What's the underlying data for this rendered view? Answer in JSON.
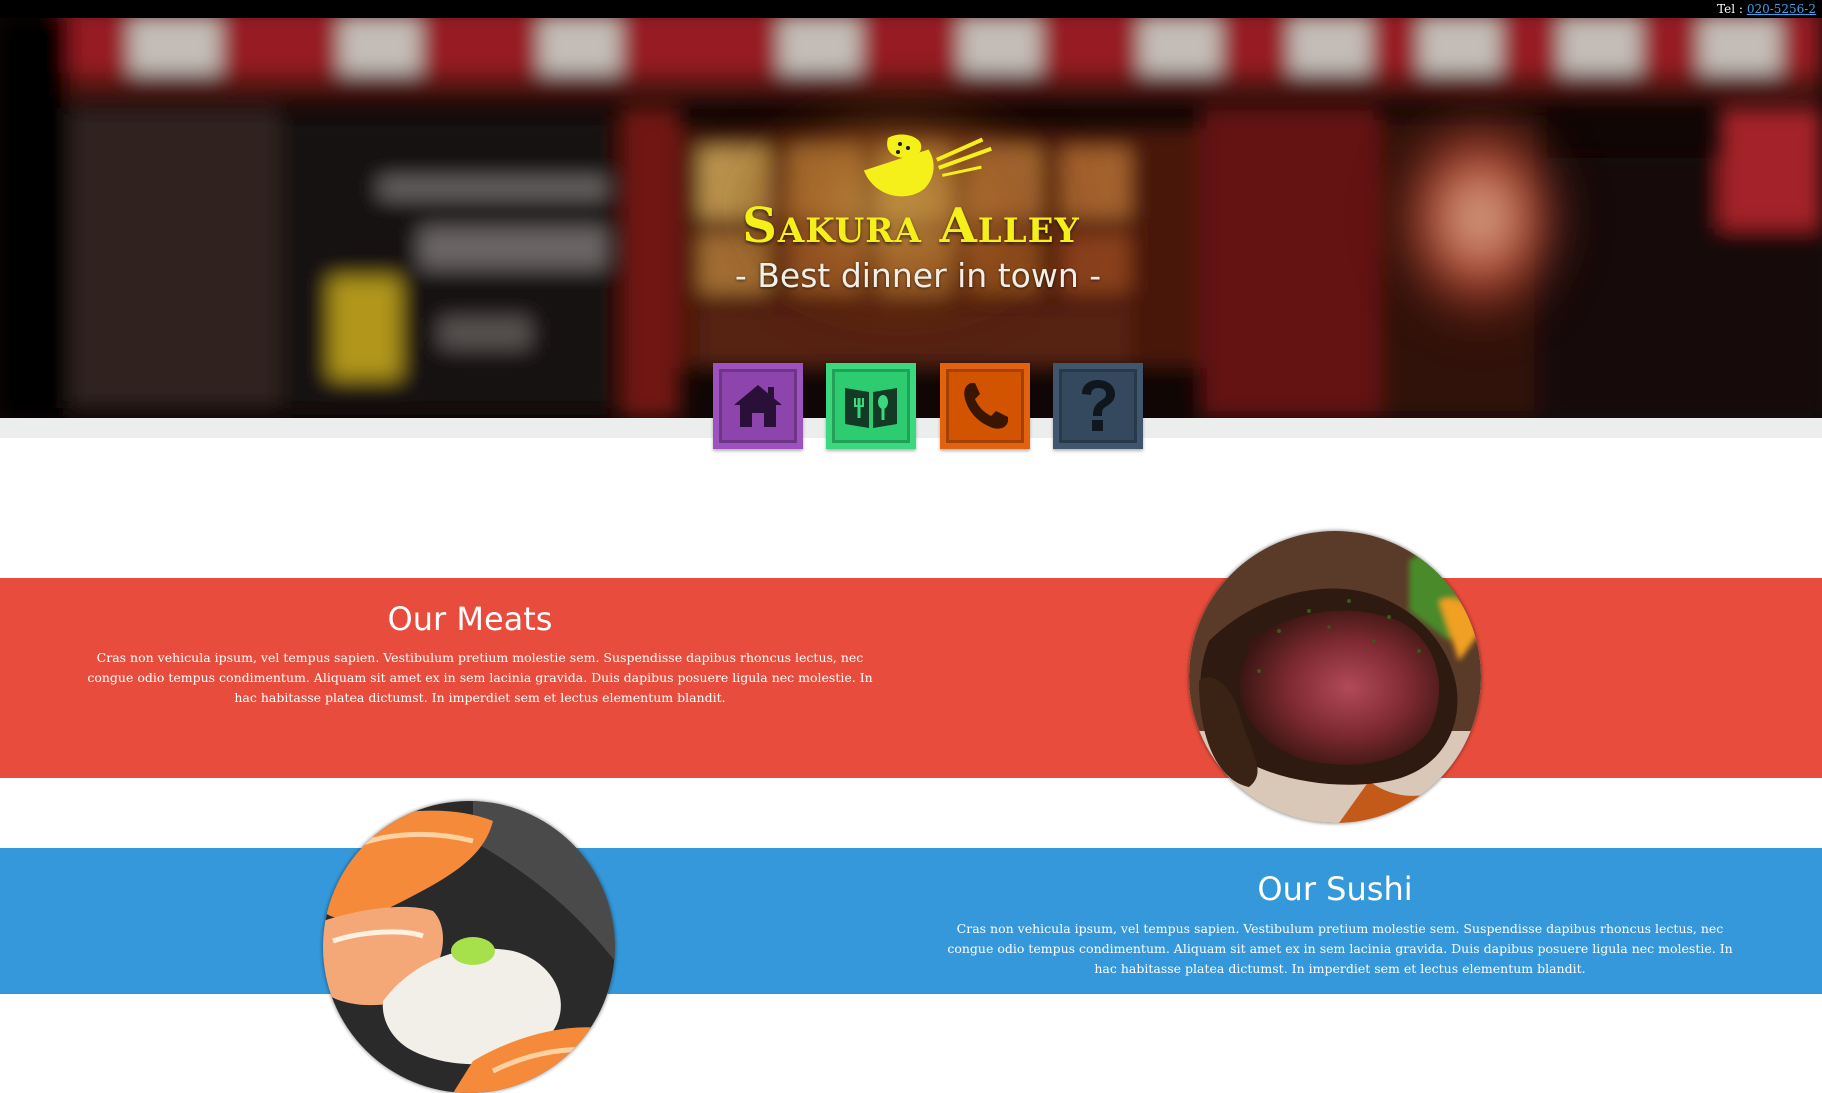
{
  "topbar": {
    "tel_label": "Tel :",
    "tel_number": "020-5256-2"
  },
  "hero": {
    "brand": "Sakura Alley",
    "tagline": "- Best dinner in town -"
  },
  "nav": [
    {
      "name": "home",
      "icon": "home-icon",
      "color": "#8e44ad"
    },
    {
      "name": "menu",
      "icon": "menu-book-icon",
      "color": "#2ecc71"
    },
    {
      "name": "contact",
      "icon": "phone-icon",
      "color": "#d35400"
    },
    {
      "name": "faq",
      "icon": "question-icon",
      "color": "#34495e"
    }
  ],
  "sections": {
    "meats": {
      "title": "Our Meats",
      "text": "Cras non vehicula ipsum, vel tempus sapien. Vestibulum pretium molestie sem. Suspendisse dapibus rhoncus lectus, nec congue odio tempus condimentum. Aliquam sit amet ex in sem lacinia gravida. Duis dapibus posuere ligula nec molestie. In hac habitasse platea dictumst. In imperdiet sem et lectus elementum blandit.",
      "color": "#e74c3c"
    },
    "sushi": {
      "title": "Our Sushi",
      "text": "Cras non vehicula ipsum, vel tempus sapien. Vestibulum pretium molestie sem. Suspendisse dapibus rhoncus lectus, nec congue odio tempus condimentum. Aliquam sit amet ex in sem lacinia gravida. Duis dapibus posuere ligula nec molestie. In hac habitasse platea dictumst. In imperdiet sem et lectus elementum blandit.",
      "color": "#3498db"
    }
  }
}
